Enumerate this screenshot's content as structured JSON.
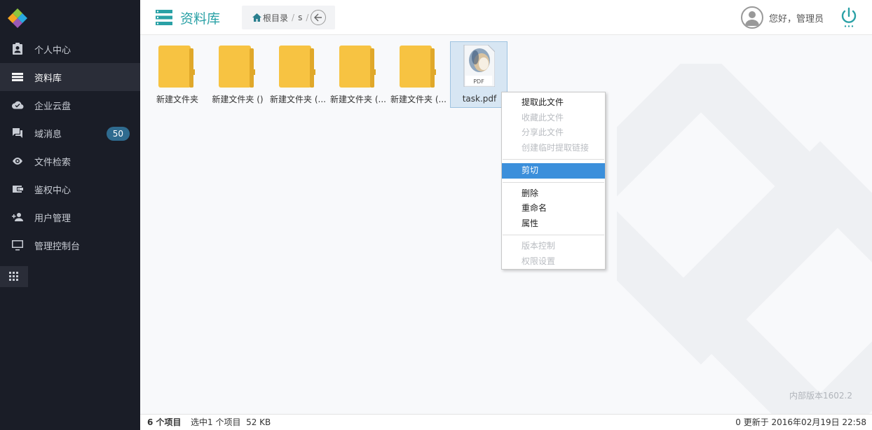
{
  "sidebar": {
    "items": [
      {
        "label": "个人中心",
        "icon": "contact-card-icon"
      },
      {
        "label": "资料库",
        "icon": "storage-icon"
      },
      {
        "label": "企业云盘",
        "icon": "cloud-check-icon"
      },
      {
        "label": "域消息",
        "icon": "chat-icon",
        "badge": "50"
      },
      {
        "label": "文件检索",
        "icon": "eye-icon"
      },
      {
        "label": "鉴权中心",
        "icon": "wallet-icon"
      },
      {
        "label": "用户管理",
        "icon": "add-user-icon"
      },
      {
        "label": "管理控制台",
        "icon": "monitor-icon"
      }
    ],
    "active_index": 1
  },
  "header": {
    "title": "资料库",
    "breadcrumb": {
      "root": "根目录",
      "sep1": "/",
      "folder": "s",
      "sep2": "/"
    },
    "greeting": "您好，管理员"
  },
  "files": [
    {
      "name": "新建文件夹",
      "type": "folder"
    },
    {
      "name": "新建文件夹 ()",
      "type": "folder"
    },
    {
      "name": "新建文件夹 (...",
      "type": "folder"
    },
    {
      "name": "新建文件夹 (...",
      "type": "folder"
    },
    {
      "name": "新建文件夹 (...",
      "type": "folder"
    },
    {
      "name": "task.pdf",
      "type": "pdf",
      "selected": true
    }
  ],
  "pdf_icon_label": "PDF",
  "context_menu": {
    "group1": [
      {
        "label": "提取此文件",
        "disabled": false
      },
      {
        "label": "收藏此文件",
        "disabled": true
      },
      {
        "label": "分享此文件",
        "disabled": true
      },
      {
        "label": "创建临时提取链接",
        "disabled": true
      }
    ],
    "group2": [
      {
        "label": "剪切",
        "highlighted": true
      }
    ],
    "group3": [
      {
        "label": "删除",
        "disabled": false
      },
      {
        "label": "重命名",
        "disabled": false
      },
      {
        "label": "属性",
        "disabled": false
      }
    ],
    "group4": [
      {
        "label": "版本控制",
        "disabled": true
      },
      {
        "label": "权限设置",
        "disabled": true
      }
    ]
  },
  "version": "内部版本1602.2",
  "footer": {
    "count": "6 个项目",
    "selection": "选中1 个项目  52 KB",
    "updated": "0 更新于 2016年02月19日 22:58"
  },
  "colors": {
    "sidebar_bg": "#1a1d27",
    "accent": "#2aa1a6",
    "folder": "#f7c342",
    "highlight": "#3b8fdb"
  }
}
